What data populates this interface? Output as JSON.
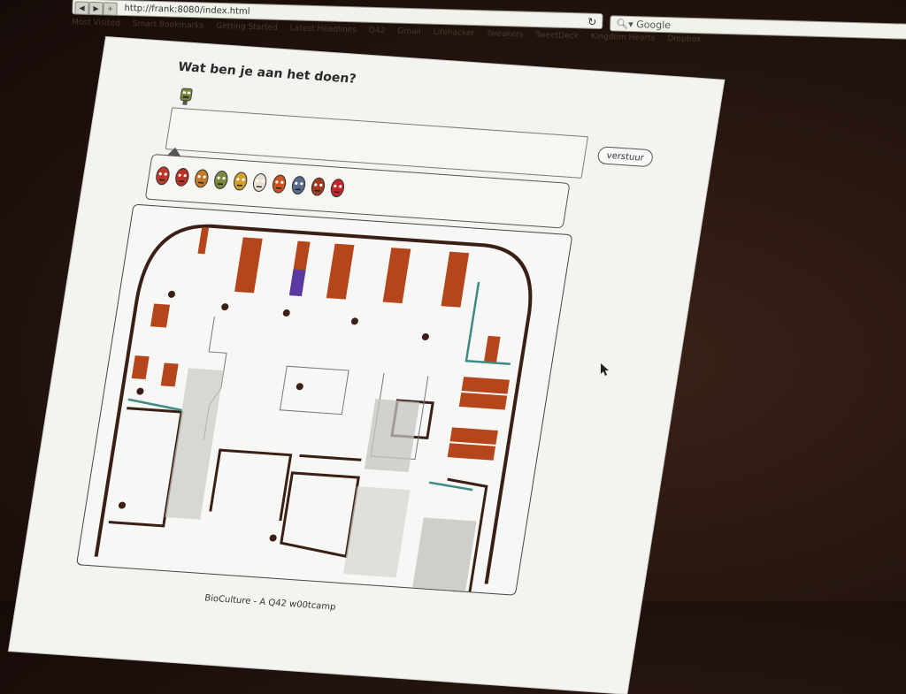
{
  "browser": {
    "url": "http://frank:8080/index.html",
    "search_placeholder": "Google",
    "bookmarks": [
      "Most Visited",
      "Smart Bookmarks",
      "Getting Started",
      "Latest Headlines",
      "Q42",
      "Gmail",
      "Lifehacker",
      "Tweakers",
      "TweetDeck",
      "Kingdom Hearts",
      "Dropbox"
    ]
  },
  "page": {
    "title": "Wat ben je aan het doen?",
    "send_label": "verstuur",
    "footer": "BioCulture - A Q42 w00tcamp"
  },
  "avatars": [
    {
      "icon": "red-mask-icon",
      "color": "#c0392b"
    },
    {
      "icon": "red-face-icon",
      "color": "#b83224"
    },
    {
      "icon": "orange-robot-icon",
      "color": "#c47a2a"
    },
    {
      "icon": "green-robot-icon",
      "color": "#7a8a3a"
    },
    {
      "icon": "yellow-face-icon",
      "color": "#d4a02a"
    },
    {
      "icon": "white-face-icon",
      "color": "#e8e0d0"
    },
    {
      "icon": "orange-egg-icon",
      "color": "#c9561f"
    },
    {
      "icon": "blue-face-icon",
      "color": "#5a6a8a"
    },
    {
      "icon": "red-splat-icon",
      "color": "#a63a1f"
    },
    {
      "icon": "spider-mask-icon",
      "color": "#c0282a"
    }
  ],
  "selected_avatar": {
    "icon": "green-robot-icon",
    "color": "#7a8a3a"
  },
  "colors": {
    "desk": "#b5461b",
    "wall": "#3a1f15",
    "teal_wall": "#3e8a84",
    "floor": "#f7f7f5",
    "stairs": "#c4c4c0"
  }
}
